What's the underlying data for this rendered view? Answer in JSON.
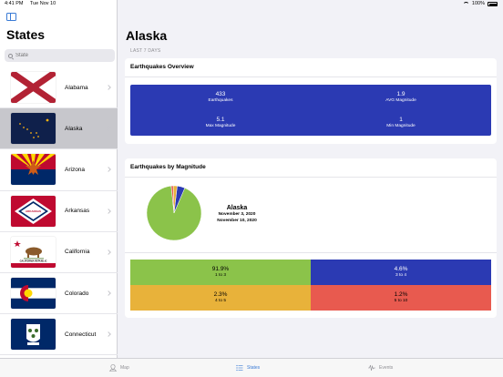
{
  "status": {
    "time": "4:41 PM",
    "date": "Tue Nov 10",
    "battery": "100%"
  },
  "sidebar": {
    "title": "States",
    "search_placeholder": "State",
    "items": [
      {
        "label": "Alabama"
      },
      {
        "label": "Alaska"
      },
      {
        "label": "Arizona"
      },
      {
        "label": "Arkansas"
      },
      {
        "label": "California"
      },
      {
        "label": "Colorado"
      },
      {
        "label": "Connecticut"
      }
    ]
  },
  "flags": {
    "arkansas_text": "ARKANSAS",
    "california_text": "CALIFORNIA REPUBLIC"
  },
  "main": {
    "title": "Alaska",
    "caption": "LAST 7 DAYS",
    "overview": {
      "title": "Earthquakes Overview",
      "earthquakes_value": "433",
      "earthquakes_label": "Earthquakes",
      "avg_value": "1.9",
      "avg_label": "AVG Magnitude",
      "max_value": "5.1",
      "max_label": "Max Magnitude",
      "min_value": "1",
      "min_label": "Min Magnitude"
    },
    "magnitude": {
      "title": "Earthquakes by Magnitude",
      "pie_title": "Alaska",
      "date_start": "November 3, 2020",
      "date_end": "November 10, 2020",
      "cells": [
        {
          "value": "91.9%",
          "range": "1 to 3"
        },
        {
          "value": "4.6%",
          "range": "3 to 4"
        },
        {
          "value": "2.3%",
          "range": "4 to 5"
        },
        {
          "value": "1.2%",
          "range": "5 to 10"
        }
      ]
    }
  },
  "chart_data": {
    "type": "pie",
    "title": "Alaska",
    "categories": [
      "1 to 3",
      "3 to 4",
      "4 to 5",
      "5 to 10"
    ],
    "values": [
      91.9,
      4.6,
      2.3,
      1.2
    ],
    "colors": [
      "#8bc34a",
      "#2b3ab3",
      "#e8b23a",
      "#e85a4f"
    ]
  },
  "tabs": [
    {
      "label": "Map"
    },
    {
      "label": "States"
    },
    {
      "label": "Events"
    }
  ]
}
